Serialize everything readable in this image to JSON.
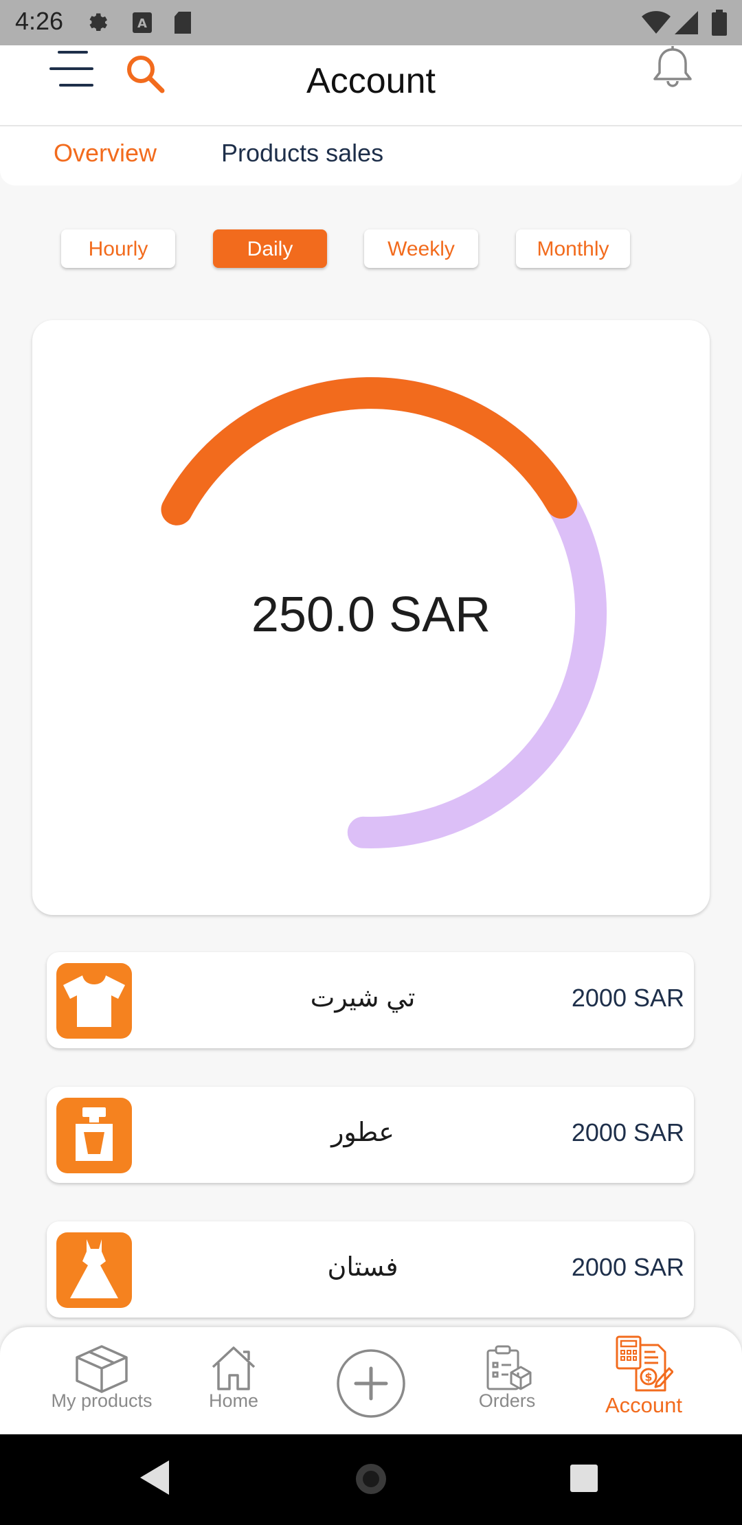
{
  "status_bar": {
    "time": "4:26"
  },
  "header": {
    "title": "Account"
  },
  "tabs": [
    {
      "label": "Overview",
      "active": true
    },
    {
      "label": "Products sales",
      "active": false
    }
  ],
  "periods": [
    {
      "label": "Hourly",
      "active": false
    },
    {
      "label": "Daily",
      "active": true
    },
    {
      "label": "Weekly",
      "active": false
    },
    {
      "label": "Monthly",
      "active": false
    }
  ],
  "gauge": {
    "value_text": "250.0 SAR",
    "progress": 0.5,
    "fill_color": "#f26b1d",
    "track_color": "#dcbff7"
  },
  "products": [
    {
      "name": "تي شيرت",
      "price": "2000 SAR",
      "icon": "tshirt-icon"
    },
    {
      "name": "عطور",
      "price": "2000 SAR",
      "icon": "perfume-icon"
    },
    {
      "name": "فستان",
      "price": "2000 SAR",
      "icon": "dress-icon"
    }
  ],
  "bottom_nav": [
    {
      "label": "My products",
      "icon": "box-icon",
      "active": false
    },
    {
      "label": "Home",
      "icon": "home-icon",
      "active": false
    },
    {
      "label": "",
      "icon": "add-icon",
      "active": false
    },
    {
      "label": "Orders",
      "icon": "orders-icon",
      "active": false
    },
    {
      "label": "Account",
      "icon": "account-icon",
      "active": true
    }
  ],
  "colors": {
    "accent": "#f26b1d",
    "icon_bg": "#f5821f",
    "navy": "#1e2f4a"
  }
}
